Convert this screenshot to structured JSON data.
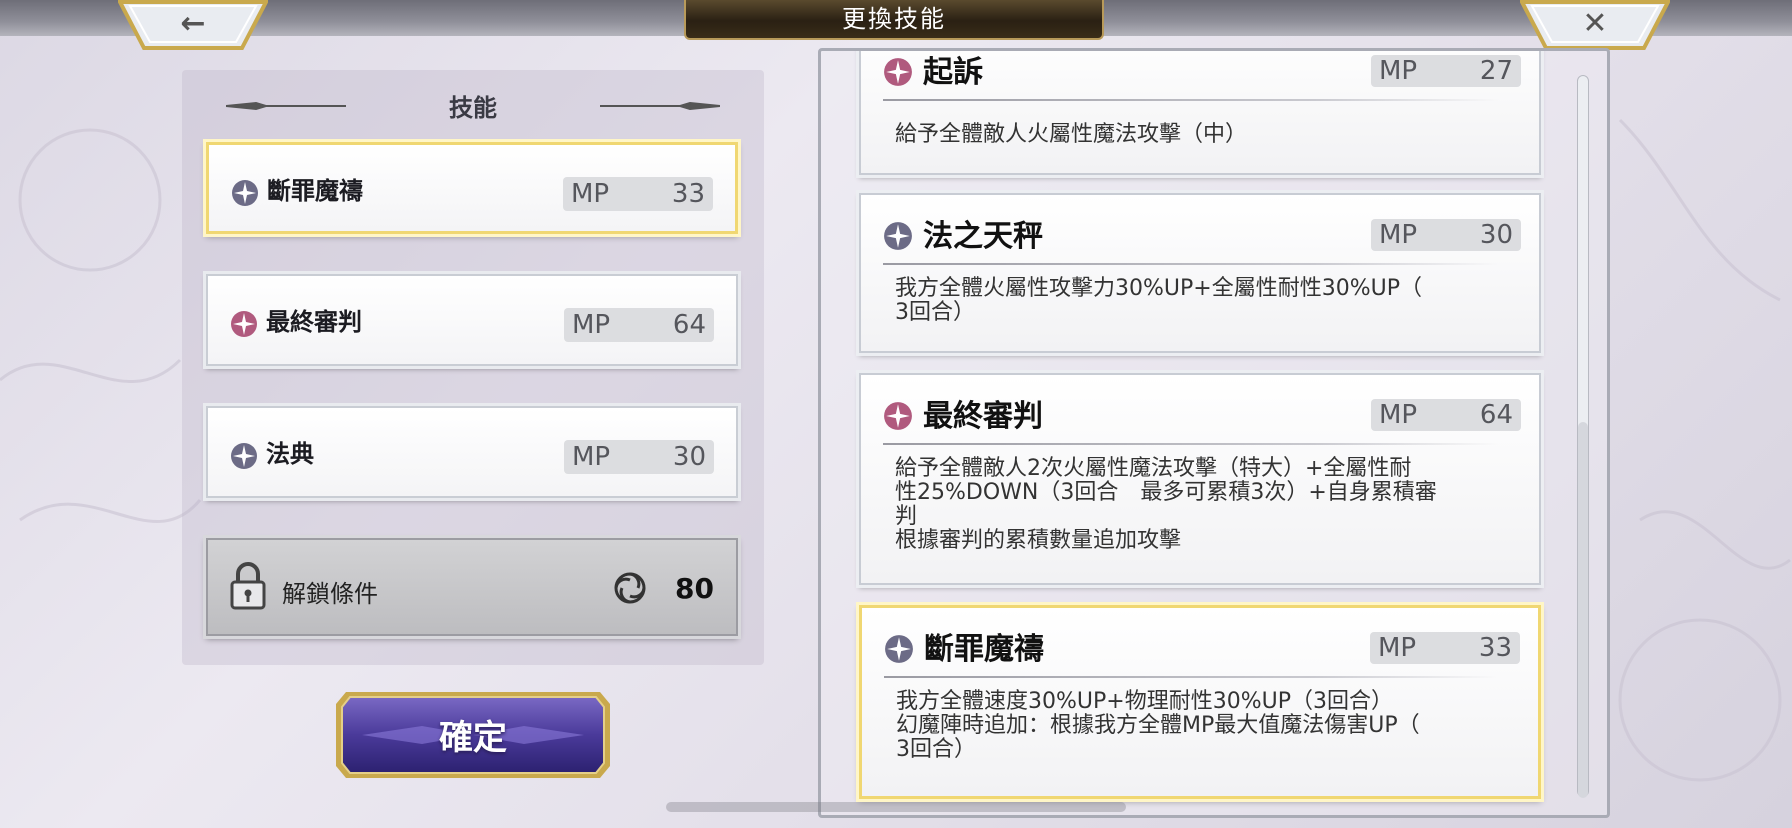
{
  "header": {
    "title": "更換技能",
    "back_icon": "←",
    "close_icon": "✕"
  },
  "left": {
    "title": "技能",
    "equipped": [
      {
        "name": "斷罪魔禱",
        "mp_label": "MP",
        "mp": "33",
        "color": "#6c6b86",
        "selected": true
      },
      {
        "name": "最終審判",
        "mp_label": "MP",
        "mp": "64",
        "color": "#b05a7e",
        "selected": false
      },
      {
        "name": "法典",
        "mp_label": "MP",
        "mp": "30",
        "color": "#6c6b86",
        "selected": false
      }
    ],
    "unlock": {
      "label": "解鎖條件",
      "value": "80"
    },
    "confirm": "確定"
  },
  "right": {
    "cards": [
      {
        "name": "起訴",
        "mp_label": "MP",
        "mp": "27",
        "color": "#b05a7e",
        "desc": "給予全體敵人火屬性魔法攻擊（中）",
        "selected": false
      },
      {
        "name": "法之天秤",
        "mp_label": "MP",
        "mp": "30",
        "color": "#6c6b86",
        "desc": "我方全體火屬性攻擊力30%UP+全屬性耐性30%UP（\n3回合）",
        "selected": false
      },
      {
        "name": "最終審判",
        "mp_label": "MP",
        "mp": "64",
        "color": "#b05a7e",
        "desc": "給予全體敵人2次火屬性魔法攻擊（特大）+全屬性耐\n性25%DOWN（3回合　最多可累積3次）+自身累積審\n判\n根據審判的累積數量追加攻擊",
        "selected": false
      },
      {
        "name": "斷罪魔禱",
        "mp_label": "MP",
        "mp": "33",
        "color": "#6c6b86",
        "desc": "我方全體速度30%UP+物理耐性30%UP（3回合）\n幻魔陣時追加：根據我方全體MP最大值魔法傷害UP（\n3回合）",
        "selected": true
      }
    ]
  }
}
